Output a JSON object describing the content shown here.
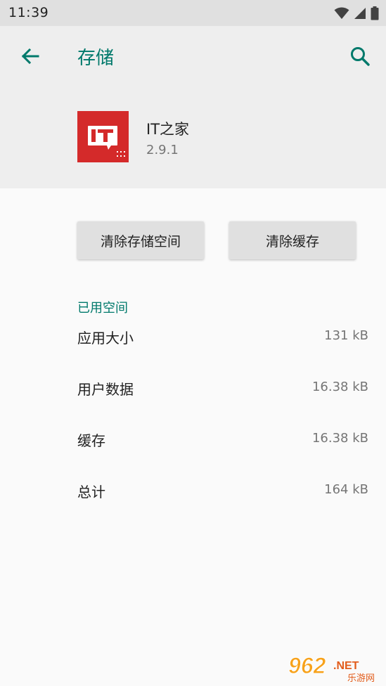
{
  "status_bar": {
    "time": "11:39"
  },
  "header": {
    "title": "存储"
  },
  "app": {
    "name": "IT之家",
    "version": "2.9.1"
  },
  "buttons": {
    "clear_storage": "清除存储空间",
    "clear_cache": "清除缓存"
  },
  "storage": {
    "section_title": "已用空间",
    "rows": [
      {
        "label": "应用大小",
        "value": "131 kB"
      },
      {
        "label": "用户数据",
        "value": "16.38 kB"
      },
      {
        "label": "缓存",
        "value": "16.38 kB"
      },
      {
        "label": "总计",
        "value": "164 kB"
      }
    ]
  },
  "watermark": {
    "primary": "962",
    "secondary": ".NET",
    "subtitle": "乐游网"
  },
  "colors": {
    "accent": "#00796b",
    "app_icon_bg": "#d42a2a",
    "status_bar_bg": "#e0e0e0"
  }
}
